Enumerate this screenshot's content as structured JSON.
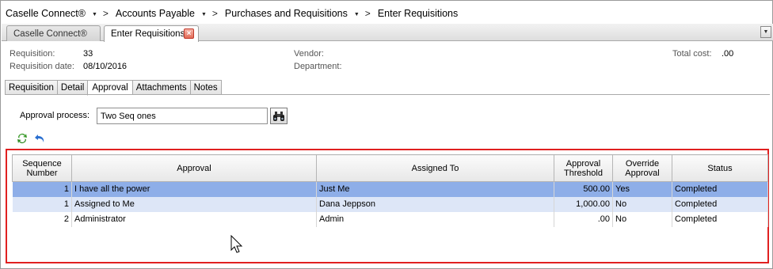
{
  "breadcrumb": [
    {
      "label": "Caselle Connect®"
    },
    {
      "label": "Accounts Payable"
    },
    {
      "label": "Purchases and Requisitions"
    },
    {
      "label": "Enter Requisitions"
    }
  ],
  "doc_tabs": [
    {
      "label": "Caselle Connect®",
      "active": false
    },
    {
      "label": "Enter Requisitions",
      "active": true
    }
  ],
  "header": {
    "requisition_label": "Requisition:",
    "requisition_value": "33",
    "req_date_label": "Requisition date:",
    "req_date_value": "08/10/2016",
    "vendor_label": "Vendor:",
    "department_label": "Department:",
    "total_cost_label": "Total cost:",
    "total_cost_value": ".00"
  },
  "sub_tabs": [
    "Requisition",
    "Detail",
    "Approval",
    "Attachments",
    "Notes"
  ],
  "active_sub_tab": "Approval",
  "approval_process": {
    "label": "Approval process:",
    "value": "Two Seq ones"
  },
  "grid": {
    "columns": [
      "Sequence Number",
      "Approval",
      "Assigned To",
      "Approval Threshold",
      "Override Approval",
      "Status"
    ],
    "rows": [
      {
        "seq": "1",
        "approval": "I have all the power",
        "assigned_to": "Just Me",
        "threshold": "500.00",
        "override": "Yes",
        "status": "Completed"
      },
      {
        "seq": "1",
        "approval": "Assigned to Me",
        "assigned_to": "Dana Jeppson",
        "threshold": "1,000.00",
        "override": "No",
        "status": "Completed"
      },
      {
        "seq": "2",
        "approval": "Administrator",
        "assigned_to": "Admin",
        "threshold": ".00",
        "override": "No",
        "status": "Completed"
      }
    ]
  },
  "colors": {
    "selected_row": "#8eaee8",
    "alt_row": "#dde6f7",
    "highlight_box": "#e02020"
  }
}
